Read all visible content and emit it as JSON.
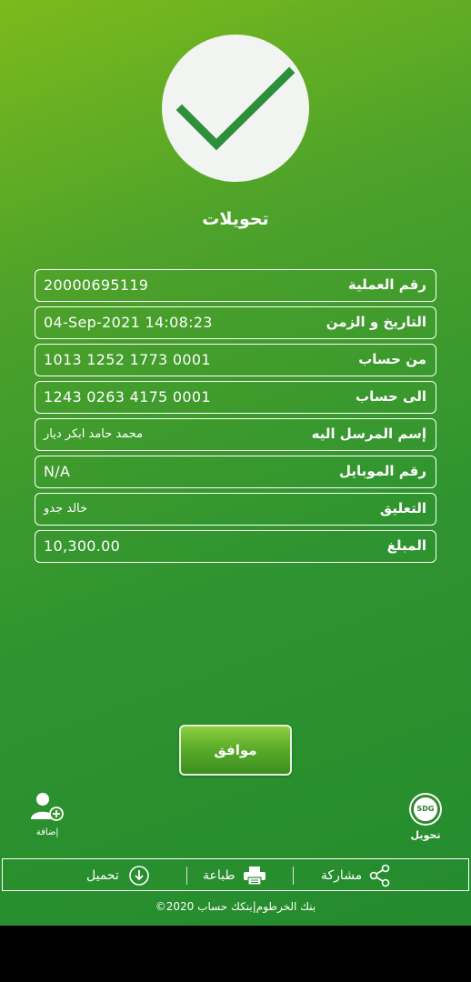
{
  "page_title": "تحويلات",
  "details": [
    {
      "label": "رقم العملية",
      "value": "20000695119"
    },
    {
      "label": "التاريخ و الزمن",
      "value": "04-Sep-2021 14:08:23"
    },
    {
      "label": "من حساب",
      "value": "1013 1252 1773 0001"
    },
    {
      "label": "الى حساب",
      "value": "1243 0263 4175 0001"
    },
    {
      "label": "إسم المرسل اليه",
      "value": "محمد حامد ابكر ديار"
    },
    {
      "label": "رقم الموبايل",
      "value": "N/A"
    },
    {
      "label": "التعليق",
      "value": "خالد جدو"
    },
    {
      "label": "المبلغ",
      "value": "10,300.00"
    }
  ],
  "ok_button": "موافق",
  "add_contact_label": "إضافة",
  "sdg_badge": "SDG",
  "transfer_label": "تحويل",
  "actions": {
    "download": "تحميل",
    "print": "طباعة",
    "share": "مشاركة"
  },
  "footer": "©2020 بنك الخرطوم|بنكك حساب",
  "colors": {
    "accent": "#2e8b2e",
    "background_top": "#7cba1c",
    "background_bottom": "#248b2e"
  }
}
